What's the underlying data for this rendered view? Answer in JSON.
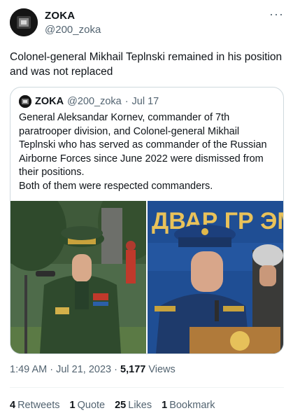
{
  "author": {
    "name": "ZOKA",
    "handle": "@200_zoka",
    "more": "···"
  },
  "tweet": {
    "text": "Colonel-general Mikhail Teplnski remained in his position and was not replaced"
  },
  "quote": {
    "name": "ZOKA",
    "handle": "@200_zoka",
    "dot": "·",
    "date": "Jul 17",
    "line1": "General Aleksandar Kornev, commander of 7th paratrooper division, and Colonel-general Mikhail Teplnski who has served as commander of the Russian Airborne Forces since June 2022 were dismissed from their positions.",
    "line2": "Both of them were respected commanders.",
    "images": [
      {
        "icon": "officer-photo-left"
      },
      {
        "icon": "officer-photo-right",
        "banner": "ДВАР  ГР  ЭМ"
      }
    ]
  },
  "meta": {
    "time": "1:49 AM",
    "sep1": "·",
    "date": "Jul 21, 2023",
    "sep2": "·",
    "views_count": "5,177",
    "views_label": "Views"
  },
  "stats": {
    "retweets_count": "4",
    "retweets_label": "Retweets",
    "quotes_count": "1",
    "quotes_label": "Quote",
    "likes_count": "25",
    "likes_label": "Likes",
    "bookmarks_count": "1",
    "bookmarks_label": "Bookmark"
  }
}
